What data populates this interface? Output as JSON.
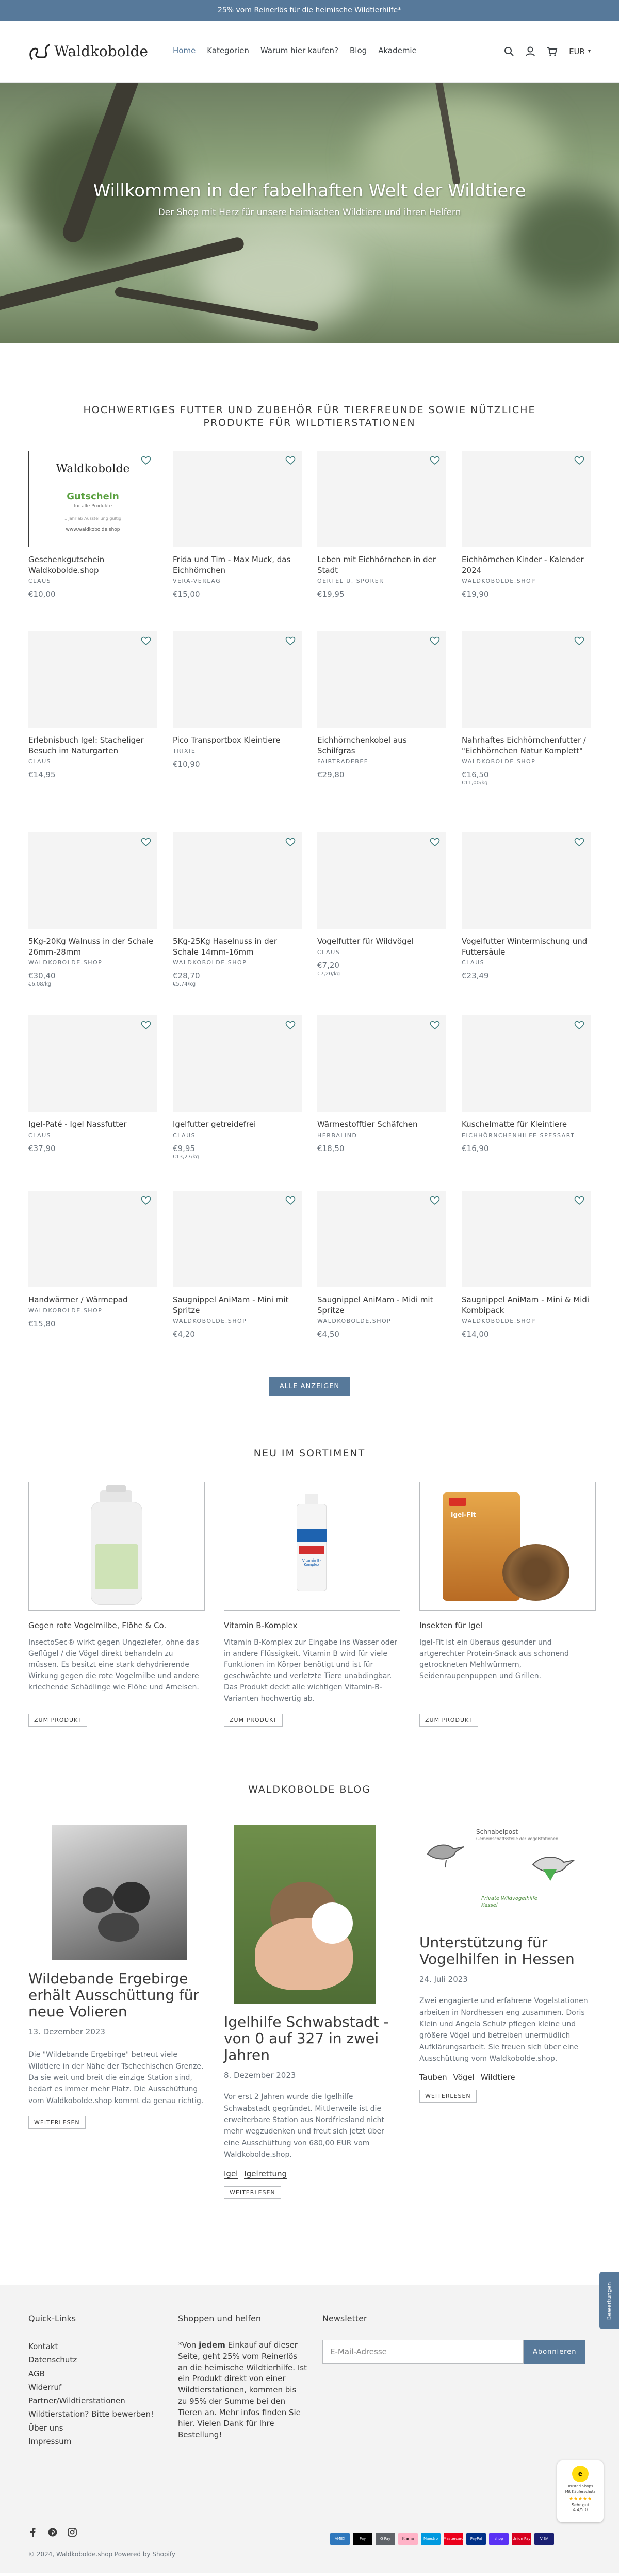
{
  "announcement": "25% vom Reinerlös für die heimische Wildtierhilfe*",
  "header": {
    "logo_text": "Waldkobolde",
    "nav": [
      "Home",
      "Kategorien",
      "Warum hier kaufen?",
      "Blog",
      "Akademie"
    ],
    "currency": "EUR"
  },
  "hero": {
    "title": "Willkommen in der fabelhaften Welt der Wildtiere",
    "subtitle": "Der Shop mit Herz für unsere heimischen Wildtiere und ihren Helfern"
  },
  "products_section": {
    "title": "Hochwertiges Futter und Zubehör für Tierfreunde sowie nützliche Produkte für Wildtierstationen",
    "products": [
      {
        "title": "Geschenkgutschein Waldkobolde.shop",
        "vendor": "CLAUS",
        "price": "€10,00",
        "unit": ""
      },
      {
        "title": "Frida und Tim - Max Muck, das Eichhörnchen",
        "vendor": "VERA-VERLAG",
        "price": "€15,00",
        "unit": ""
      },
      {
        "title": "Leben mit Eichhörnchen in der Stadt",
        "vendor": "OERTEL U. SPÖRER",
        "price": "€19,95",
        "unit": ""
      },
      {
        "title": "Eichhörnchen Kinder - Kalender 2024",
        "vendor": "WALDKOBOLDE.SHOP",
        "price": "€19,90",
        "unit": ""
      },
      {
        "title": "Erlebnisbuch Igel: Stacheliger Besuch im Naturgarten",
        "vendor": "CLAUS",
        "price": "€14,95",
        "unit": ""
      },
      {
        "title": "Pico Transportbox Kleintiere",
        "vendor": "TRIXIE",
        "price": "€10,90",
        "unit": ""
      },
      {
        "title": "Eichhörnchenkobel aus Schilfgras",
        "vendor": "FAIRTRADEBEE",
        "price": "€29,80",
        "unit": ""
      },
      {
        "title": "Nahrhaftes Eichhörnchenfutter / \"Eichhörnchen Natur Komplett\"",
        "vendor": "WALDKOBOLDE.SHOP",
        "price": "€16,50",
        "unit": "€11,00/kg"
      },
      {
        "title": "5Kg-20Kg Walnuss in der Schale 26mm-28mm",
        "vendor": "WALDKOBOLDE.SHOP",
        "price": "€30,40",
        "unit": "€6,08/kg"
      },
      {
        "title": "5Kg-25Kg Haselnuss in der Schale 14mm-16mm",
        "vendor": "WALDKOBOLDE.SHOP",
        "price": "€28,70",
        "unit": "€5,74/kg"
      },
      {
        "title": "Vogelfutter für Wildvögel",
        "vendor": "CLAUS",
        "price": "€7,20",
        "unit": "€7,20/kg"
      },
      {
        "title": "Vogelfutter Wintermischung und Futtersäule",
        "vendor": "CLAUS",
        "price": "€23,49",
        "unit": ""
      },
      {
        "title": "Igel-Paté - Igel Nassfutter",
        "vendor": "CLAUS",
        "price": "€37,90",
        "unit": ""
      },
      {
        "title": "Igelfutter getreidefrei",
        "vendor": "CLAUS",
        "price": "€9,95",
        "unit": "€13,27/kg"
      },
      {
        "title": "Wärmestofftier Schäfchen",
        "vendor": "HERBALIND",
        "price": "€18,50",
        "unit": ""
      },
      {
        "title": "Kuschelmatte für Kleintiere",
        "vendor": "EICHHÖRNCHENHILFE SPESSART",
        "price": "€16,90",
        "unit": ""
      },
      {
        "title": "Handwärmer / Wärmepad",
        "vendor": "WALDKOBOLDE.SHOP",
        "price": "€15,80",
        "unit": ""
      },
      {
        "title": "Saugnippel AniMam - Mini mit Spritze",
        "vendor": "WALDKOBOLDE.SHOP",
        "price": "€4,20",
        "unit": ""
      },
      {
        "title": "Saugnippel AniMam - Midi mit Spritze",
        "vendor": "WALDKOBOLDE.SHOP",
        "price": "€4,50",
        "unit": ""
      },
      {
        "title": "Saugnippel AniMam - Mini & Midi Kombipack",
        "vendor": "WALDKOBOLDE.SHOP",
        "price": "€14,00",
        "unit": ""
      }
    ],
    "voucher": {
      "brand": "Waldkobolde",
      "label": "Gutschein",
      "sub": "für alle Produkte",
      "note": "1 Jahr ab Ausstellung gültig",
      "url": "www.waldkobolde.shop"
    },
    "show_all": "Alle anzeigen"
  },
  "new_section": {
    "title": "Neu im Sortiment",
    "items": [
      {
        "title": "Gegen rote Vogelmilbe, Flöhe & Co.",
        "desc": "InsectoSec® wirkt gegen Ungeziefer, ohne das Geflügel / die Vögel direkt behandeln zu müssen. Es besitzt eine stark dehydrierende Wirkung gegen die rote Vogelmilbe und andere kriechende Schädlinge wie Flöhe und Ameisen.",
        "button": "Zum Produkt"
      },
      {
        "title": "Vitamin B-Komplex",
        "desc": "Vitamin B-Komplex zur Eingabe ins Wasser oder in andere Flüssigkeit. Vitamin B wird für viele Funktionen im Körper benötigt und ist für geschwächte und verletzte Tiere unabdingbar. Das Produkt deckt alle wichtigen Vitamin-B-Varianten hochwertig ab.",
        "button": "Zum Produkt"
      },
      {
        "title": "Insekten für Igel",
        "desc": "Igel-Fit ist ein überaus gesunder und artgerechter Protein-Snack aus schonend getrockneten Mehlwürmern, Seidenraupenpuppen und Grillen.",
        "button": "Zum Produkt"
      }
    ],
    "labels": {
      "vitamin": "Vitamin B-Komplex",
      "igelfit": "Igel-Fit"
    }
  },
  "blog_section": {
    "title": "Waldkobolde Blog",
    "posts": [
      {
        "title": "Wildebande Ergebirge erhält Ausschüttung für neue Volieren",
        "date": "13. Dezember 2023",
        "desc": "Die \"Wildebande Ergebirge\" betreut viele Wildtiere in der Nähe der Tschechischen Grenze. Da sie weit und breit die einzige Station sind, bedarf es immer mehr Platz. Die Ausschüttung vom Waldkobolde.shop kommt da genau richtig.",
        "tags": [],
        "button": "Weiterlesen"
      },
      {
        "title": "Igelhilfe Schwabstadt - von 0 auf 327 in zwei Jahren",
        "date": "8. Dezember 2023",
        "desc": "Vor erst 2 Jahren wurde die Igelhilfe Schwabstadt gegründet. Mittlerweile ist die erweiterbare Station aus Nordfriesland nicht mehr wegzudenken und freut sich jetzt über eine Ausschüttung von 680,00 EUR vom Waldkobolde.shop.",
        "tags": [
          "Igel",
          "Igelrettung"
        ],
        "button": "Weiterlesen"
      },
      {
        "title": "Unterstützung für Vogelhilfen in Hessen",
        "date": "24. Juli 2023",
        "desc": "Zwei engagierte und erfahrene Vogelstationen arbeiten in Nordhessen eng zusammen. Doris Klein und Angela Schulz pflegen kleine und größere Vögel und betreiben unermüdlich Aufklärungsarbeit. Sie freuen sich über eine Ausschüttung vom Waldkobolde.shop.",
        "tags": [
          "Tauben",
          "Vögel",
          "Wildtiere"
        ],
        "button": "Weiterlesen"
      }
    ],
    "sketch": {
      "top": "Schnabelpost",
      "sub": "Gemeinschaftsstelle der Vogelstationen",
      "caption": "Private Wildvogelhilfe Kassel"
    }
  },
  "footer": {
    "quicklinks_title": "Quick-Links",
    "quicklinks": [
      "Kontakt",
      "Datenschutz",
      "AGB",
      "Widerruf",
      "Partner/Wildtierstationen",
      "Wildtierstation? Bitte bewerben!",
      "Über uns",
      "Impressum"
    ],
    "shop_title": "Shoppen und helfen",
    "shop_text_before": "*Von ",
    "shop_text_bold": "jedem",
    "shop_text_after": " Einkauf auf dieser Seite, geht 25% vom Reinerlös an die heimische Wildtierhilfe. Ist ein Produkt direkt von einer Wildtierstationen, kommen bis zu 95% der Summe bei den Tieren an.  Mehr infos finden Sie hier.  Vielen Dank für Ihre Bestellung!",
    "newsletter_title": "Newsletter",
    "email_placeholder": "E-Mail-Adresse",
    "subscribe": "Abonnieren",
    "copyright": "© 2024, Waldkobolde.shop Powered by Shopify",
    "payments": [
      "AMEX",
      "Pay",
      "G Pay",
      "Klarna",
      "Maestro",
      "Mastercard",
      "PayPal",
      "shop",
      "Union Pay",
      "VISA"
    ],
    "badge": {
      "brand": "Trusted Shops",
      "score": "4.4/5.0",
      "rating": "Sehr gut",
      "label": "Mit Käuferschutz"
    },
    "side_tab": "Bewertungen"
  }
}
